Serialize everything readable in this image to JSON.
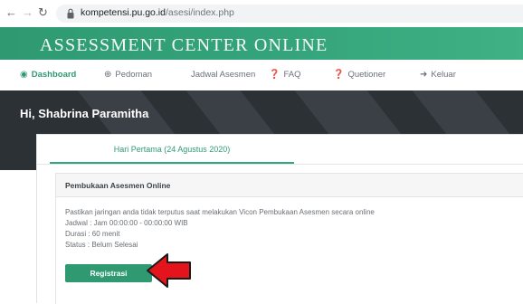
{
  "browser": {
    "back_icon": "arrow-left-icon",
    "forward_icon": "arrow-right-icon",
    "reload_icon": "reload-icon",
    "url_domain": "kompetensi.pu.go.id",
    "url_path": "/asesi/index.php"
  },
  "banner": {
    "title": "ASSESSMENT CENTER ONLINE"
  },
  "menu": {
    "items": [
      {
        "label": "Dashboard",
        "icon": "dashboard-icon",
        "icon_glyph": "🖌"
      },
      {
        "label": "Pedoman",
        "icon": "globe-icon",
        "icon_glyph": "⊕"
      },
      {
        "label": "Jadwal Asesmen",
        "icon": "",
        "icon_glyph": ""
      },
      {
        "label": "FAQ",
        "icon": "question-icon",
        "icon_glyph": "❓"
      },
      {
        "label": "Quetioner",
        "icon": "question-icon",
        "icon_glyph": "❓"
      },
      {
        "label": "Keluar",
        "icon": "sign-out-icon",
        "icon_glyph": "→]"
      }
    ]
  },
  "hero": {
    "greeting": "Hi, Shabrina Paramitha"
  },
  "tab": {
    "label": "Hari Pertama (24 Agustus 2020)"
  },
  "panel": {
    "title": "Pembukaan Asesmen Online",
    "lines": [
      "Pastikan jaringan anda tidak terputus saat melakukan Vicon Pembukaan Asesmen secara online",
      "Jadwal : Jam 00:00:00 - 00:00:00 WIB",
      "Durasi : 60 menit",
      "Status : Belum Selesai"
    ],
    "button_label": "Registrasi"
  },
  "colors": {
    "accent": "#2f9a72",
    "hero": "#2c3136",
    "annotation_arrow": "#e3141b"
  }
}
